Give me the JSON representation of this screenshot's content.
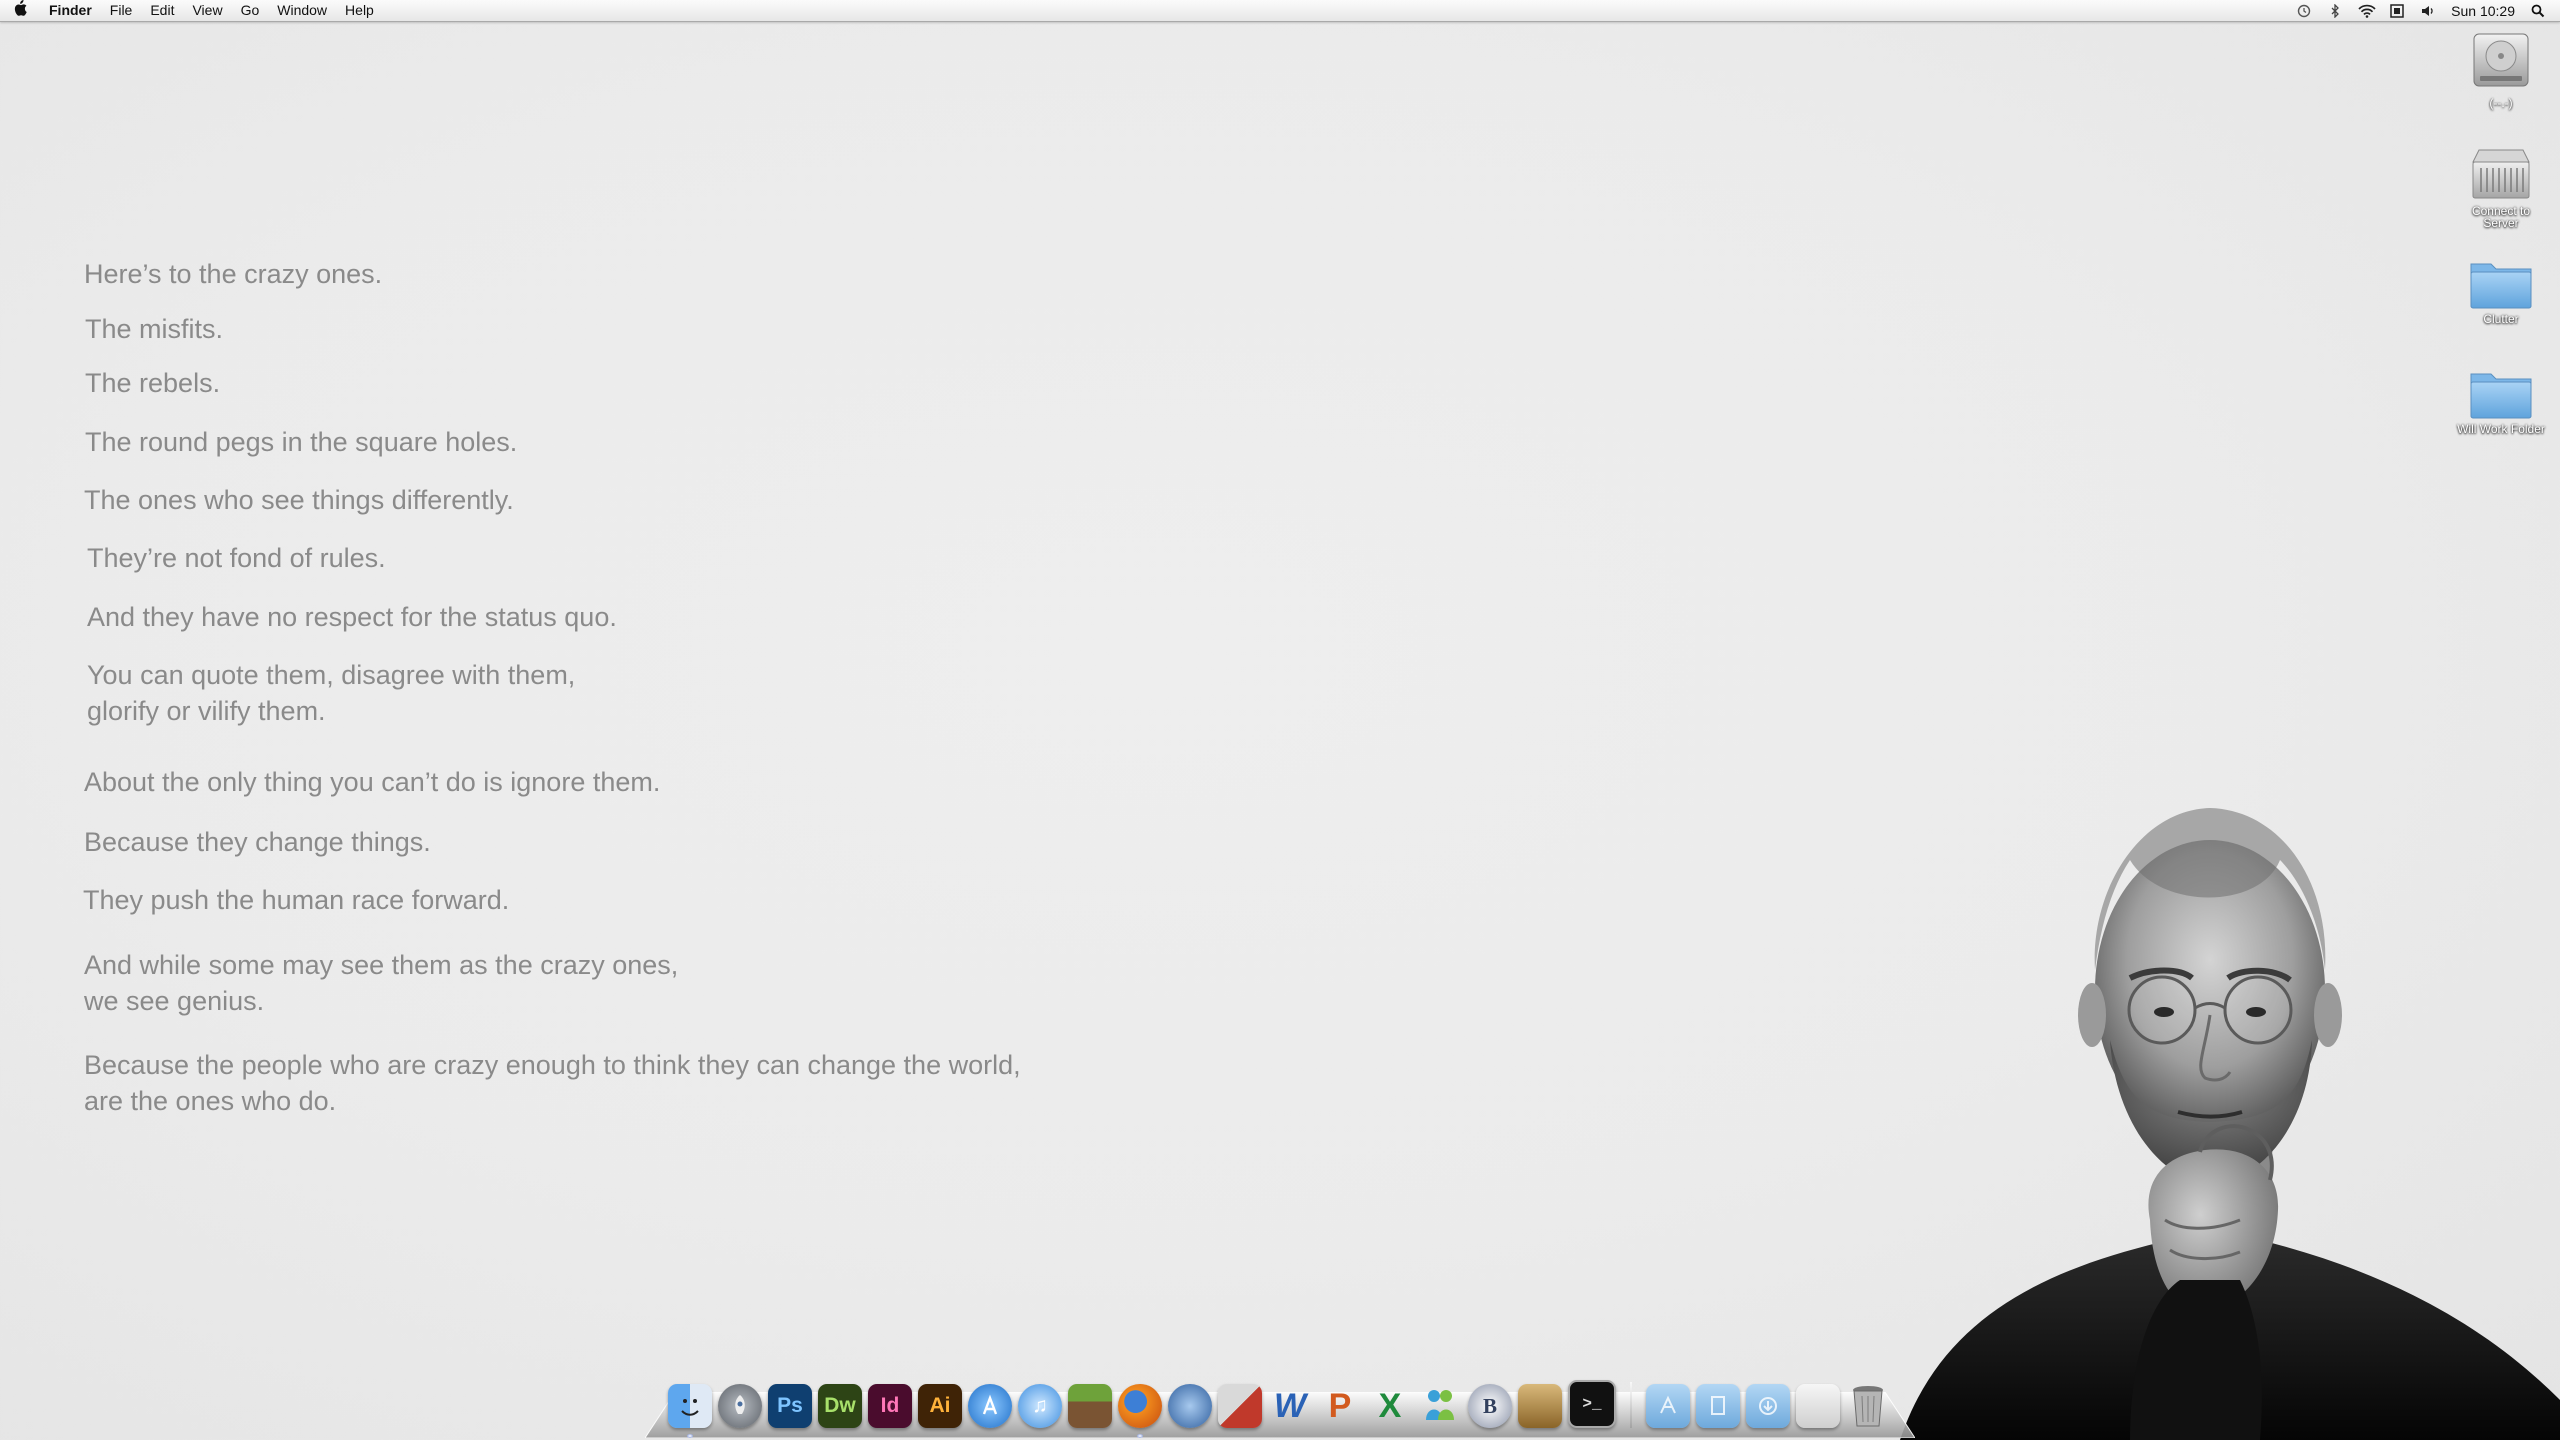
{
  "menubar": {
    "apple": "",
    "app_name": "Finder",
    "menus": [
      "File",
      "Edit",
      "View",
      "Go",
      "Window",
      "Help"
    ],
    "status_icons": [
      "time-machine-icon",
      "bluetooth-icon",
      "wifi-icon",
      "input-menu-icon",
      "volume-icon"
    ],
    "clock": "Sun 10:29",
    "spotlight": "spotlight-icon"
  },
  "quote": {
    "lines": [
      "Here’s to the crazy ones.",
      "The misfits.",
      "The rebels.",
      "The round pegs in the square holes.",
      "The ones who see things differently.",
      "They’re not fond of rules.",
      "And they have no respect for the status quo.",
      "You can quote them, disagree with them,",
      "glorify or vilify them.",
      "About the only thing you can’t do is ignore them.",
      "Because they change things.",
      "They push the human race forward.",
      "And while some may see them as the crazy ones,",
      "we see genius.",
      "Because the people who are crazy enough to think they can change the world,",
      "are the ones who do."
    ]
  },
  "desktop": {
    "icons": [
      {
        "label": "(--.-)",
        "type": "hard-drive-icon"
      },
      {
        "label": "Connect to Server",
        "type": "server-icon"
      },
      {
        "label": "Clutter",
        "type": "folder-icon"
      },
      {
        "label": "Will Work Folder",
        "type": "folder-icon"
      }
    ]
  },
  "dock": {
    "apps": [
      {
        "name": "finder",
        "text": "",
        "color": "#4a8fdc"
      },
      {
        "name": "launchpad",
        "text": "",
        "color": "#8a8f96"
      },
      {
        "name": "photoshop",
        "text": "Ps",
        "color": "#1d6fb8"
      },
      {
        "name": "dreamweaver",
        "text": "Dw",
        "color": "#5b8a2a"
      },
      {
        "name": "indesign",
        "text": "Id",
        "color": "#b0246d"
      },
      {
        "name": "illustrator",
        "text": "Ai",
        "color": "#d8860d"
      },
      {
        "name": "app-store",
        "text": "",
        "color": "#2f8fe0"
      },
      {
        "name": "itunes",
        "text": "♫",
        "color": "#2f7fd6"
      },
      {
        "name": "minecraft",
        "text": "",
        "color": "#6b8a3a"
      },
      {
        "name": "firefox",
        "text": "",
        "color": "#e06a1a"
      },
      {
        "name": "thunderbird",
        "text": "",
        "color": "#3f7ec2"
      },
      {
        "name": "parallels",
        "text": "",
        "color": "#c0392b"
      },
      {
        "name": "word",
        "text": "W",
        "color": "#2a62b6"
      },
      {
        "name": "powerpoint",
        "text": "P",
        "color": "#d25a1e"
      },
      {
        "name": "excel",
        "text": "X",
        "color": "#1f8a3c"
      },
      {
        "name": "messenger",
        "text": "",
        "color": "#3aa0d8"
      },
      {
        "name": "bbedit",
        "text": "B",
        "color": "#5a6a8a"
      },
      {
        "name": "archive-utility",
        "text": "",
        "color": "#a07a3c"
      },
      {
        "name": "terminal",
        "text": ">_",
        "color": "#222222"
      }
    ],
    "stacks": [
      {
        "name": "applications-stack",
        "color": "#7fb6e6"
      },
      {
        "name": "documents-stack",
        "color": "#7fb6e6"
      },
      {
        "name": "downloads-stack",
        "color": "#7fb6e6"
      },
      {
        "name": "recent-stack",
        "color": "#d8d8d8"
      },
      {
        "name": "trash",
        "color": "#9a9a9a"
      }
    ]
  }
}
